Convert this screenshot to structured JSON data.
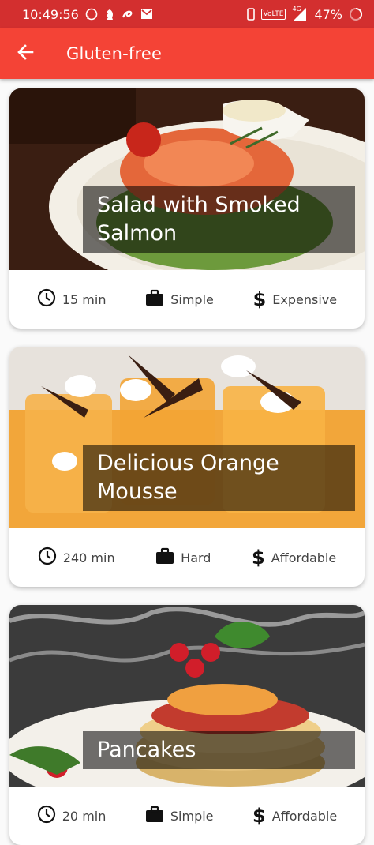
{
  "status_bar": {
    "time": "10:49:56",
    "battery": "47%",
    "network": "VoLTE",
    "signal": "4G"
  },
  "app_bar": {
    "title": "Gluten-free",
    "back_icon": "arrow-back-icon"
  },
  "colors": {
    "status_bar": "#d32f2f",
    "app_bar": "#f44336"
  },
  "meals": [
    {
      "title": "Salad with Smoked Salmon",
      "duration": "15 min",
      "complexity": "Simple",
      "affordability": "Expensive"
    },
    {
      "title": "Delicious Orange Mousse",
      "duration": "240 min",
      "complexity": "Hard",
      "affordability": "Affordable"
    },
    {
      "title": "Pancakes",
      "duration": "20 min",
      "complexity": "Simple",
      "affordability": "Affordable"
    }
  ]
}
